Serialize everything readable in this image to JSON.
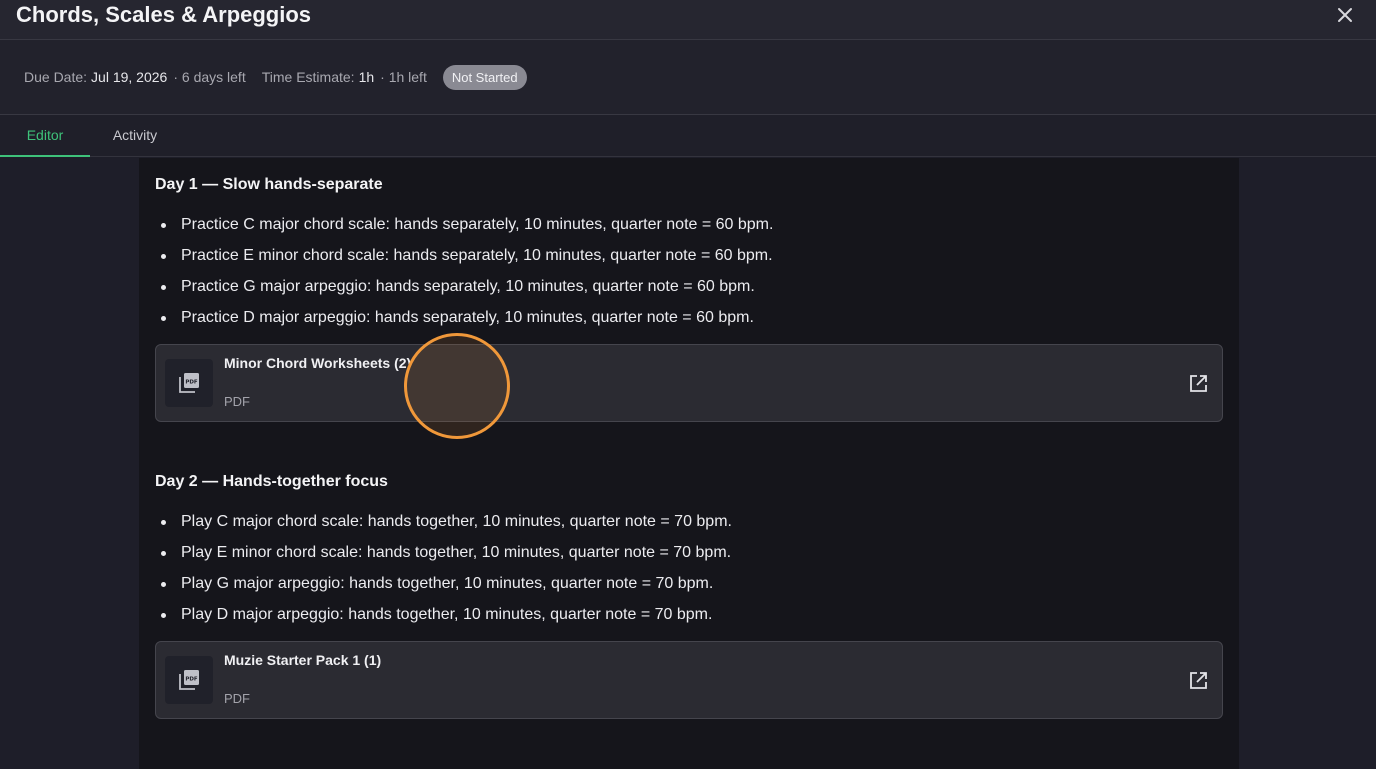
{
  "header": {
    "title": "Chords, Scales & Arpeggios",
    "close_icon": "close-icon"
  },
  "meta": {
    "due_label": "Due Date:",
    "due_value": "Jul 19, 2026",
    "due_sub": "· 6 days left",
    "time_label": "Time Estimate:",
    "time_value": "1h",
    "time_sub": "· 1h left",
    "status": "Not Started"
  },
  "tabs": [
    {
      "label": "Editor",
      "active": true
    },
    {
      "label": "Activity",
      "active": false
    }
  ],
  "sections": [
    {
      "title": "Day 1 — Slow hands-separate",
      "items": [
        "Practice C major chord scale: hands separately, 10 minutes, quarter note = 60 bpm.",
        "Practice E minor chord scale: hands separately, 10 minutes, quarter note = 60 bpm.",
        "Practice G major arpeggio: hands separately, 10 minutes, quarter note = 60 bpm.",
        "Practice D major arpeggio: hands separately, 10 minutes, quarter note = 60 bpm."
      ],
      "attachment": {
        "name": "Minor Chord Worksheets (2)",
        "type": "PDF",
        "icon": "pdf-icon",
        "action_icon": "open-external-icon"
      }
    },
    {
      "title": "Day 2 — Hands-together focus",
      "items": [
        "Play C major chord scale: hands together, 10 minutes, quarter note = 70 bpm.",
        "Play E minor chord scale: hands together, 10 minutes, quarter note = 70 bpm.",
        "Play G major arpeggio: hands together, 10 minutes, quarter note = 70 bpm.",
        "Play D major arpeggio: hands together, 10 minutes, quarter note = 70 bpm."
      ],
      "attachment": {
        "name": "Muzie Starter Pack 1 (1)",
        "type": "PDF",
        "icon": "pdf-icon",
        "action_icon": "open-external-icon"
      }
    }
  ],
  "colors": {
    "accent": "#3ec27a",
    "cursor_highlight": "#f0983a",
    "badge_bg": "#8a8a93"
  }
}
